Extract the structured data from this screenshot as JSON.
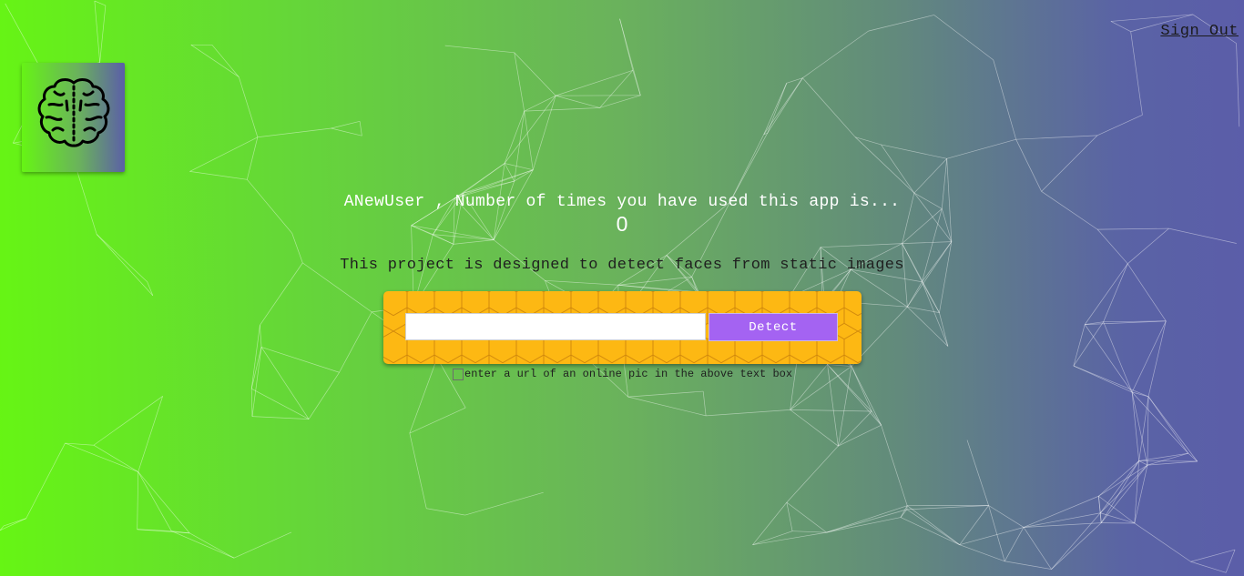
{
  "header": {
    "sign_out_label": "Sign Out"
  },
  "logo": {
    "icon": "brain-icon"
  },
  "main": {
    "greeting": "ANewUser , Number of times you have used this app is...",
    "usage_count": "0",
    "description": "This project is designed to detect faces from static images"
  },
  "form": {
    "url_value": "",
    "url_placeholder": "",
    "detect_label": "Detect",
    "hint": "enter a url of an online pic in the above text box"
  },
  "colors": {
    "gradient_start": "#66f514",
    "gradient_end": "#5b5da9",
    "panel": "#fdb813",
    "button": "#a463f2"
  }
}
